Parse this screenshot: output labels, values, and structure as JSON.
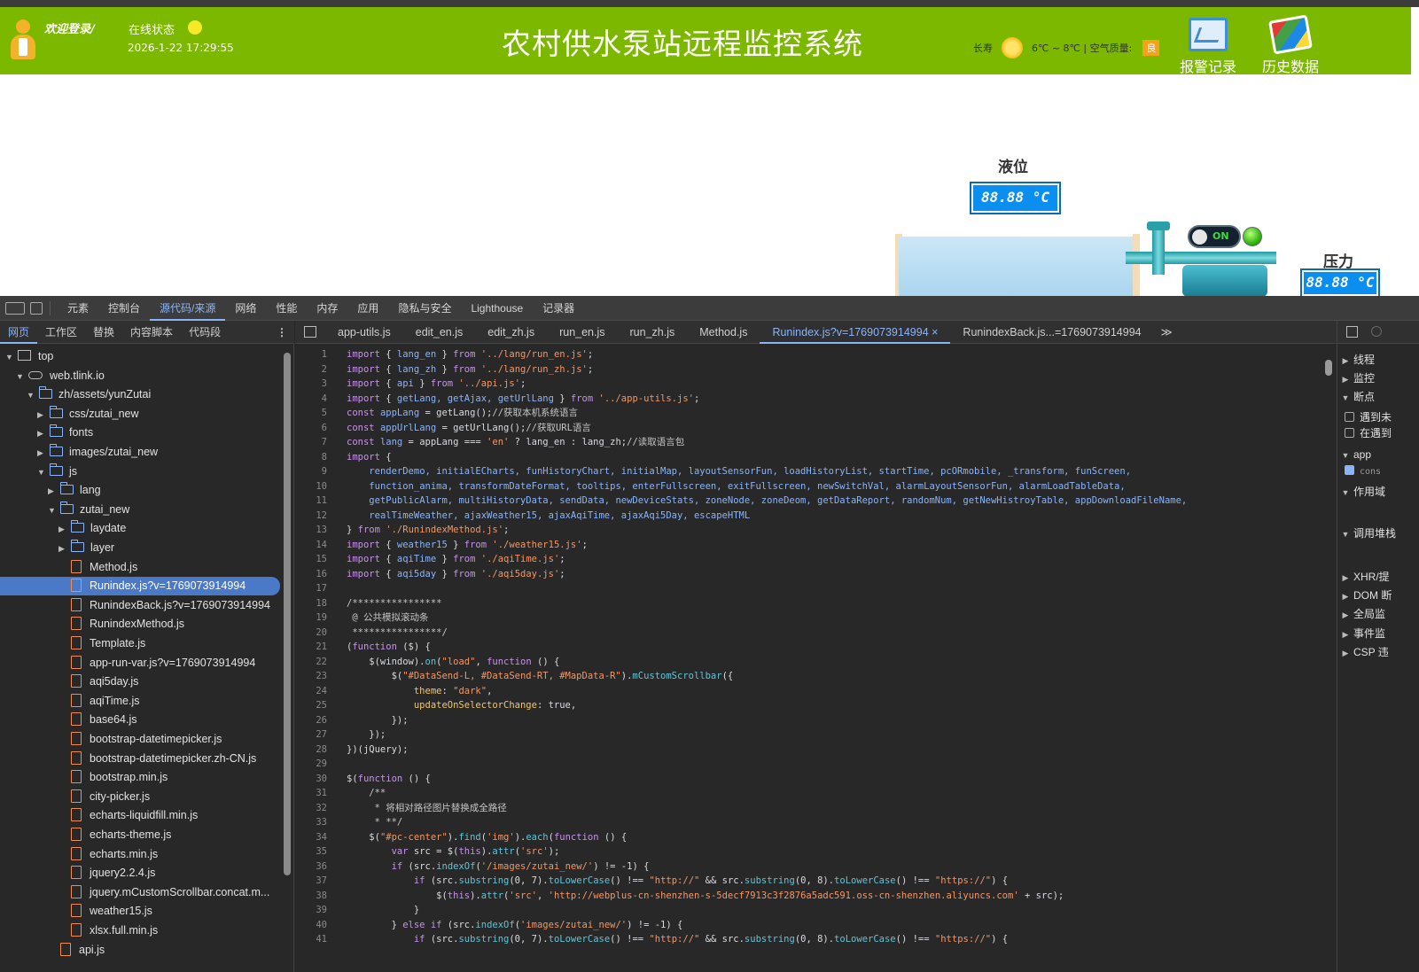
{
  "banner": {
    "welcome": "欢迎登录/",
    "status_label": "在线状态",
    "datetime": "2026-1-22 17:29:55",
    "title": "农村供水泵站远程监控系统",
    "city": "长寿",
    "temp": "6℃ ~ 8℃ | 空气质量:",
    "aqi": "良",
    "alarm_label": "报警记录",
    "history_label": "历史数据"
  },
  "scada": {
    "level_label": "液位",
    "level_value": "88.88 °C",
    "pressure_label": "压力",
    "pressure_value": "88.88 °C",
    "switch_label": "ON"
  },
  "devtools": {
    "top_tabs": [
      "元素",
      "控制台",
      "源代码/来源",
      "网络",
      "性能",
      "内存",
      "应用",
      "隐私与安全",
      "Lighthouse",
      "记录器"
    ],
    "nav_tabs": [
      "网页",
      "工作区",
      "替换",
      "内容脚本",
      "代码段"
    ],
    "file_tabs": [
      "app-utils.js",
      "edit_en.js",
      "edit_zh.js",
      "run_en.js",
      "run_zh.js",
      "Method.js",
      "Runindex.js?v=1769073914994 ×",
      "RunindexBack.js...=1769073914994"
    ],
    "more_tabs": "≫",
    "tree": [
      {
        "label": "top",
        "depth": 0,
        "type": "frame",
        "caret": "▼"
      },
      {
        "label": "web.tlink.io",
        "depth": 1,
        "type": "cloud",
        "caret": "▼"
      },
      {
        "label": "zh/assets/yunZutai",
        "depth": 2,
        "type": "folder",
        "caret": "▼"
      },
      {
        "label": "css/zutai_new",
        "depth": 3,
        "type": "folder",
        "caret": "▶"
      },
      {
        "label": "fonts",
        "depth": 3,
        "type": "folder",
        "caret": "▶"
      },
      {
        "label": "images/zutai_new",
        "depth": 3,
        "type": "folder",
        "caret": "▶"
      },
      {
        "label": "js",
        "depth": 3,
        "type": "folder",
        "caret": "▼"
      },
      {
        "label": "lang",
        "depth": 4,
        "type": "folder",
        "caret": "▶"
      },
      {
        "label": "zutai_new",
        "depth": 4,
        "type": "folder",
        "caret": "▼"
      },
      {
        "label": "laydate",
        "depth": 5,
        "type": "folder",
        "caret": "▶"
      },
      {
        "label": "layer",
        "depth": 5,
        "type": "folder",
        "caret": "▶"
      },
      {
        "label": "Method.js",
        "depth": 5,
        "type": "file",
        "caret": ""
      },
      {
        "label": "Runindex.js?v=1769073914994",
        "depth": 5,
        "type": "file",
        "caret": "",
        "selected": true
      },
      {
        "label": "RunindexBack.js?v=1769073914994",
        "depth": 5,
        "type": "file",
        "caret": ""
      },
      {
        "label": "RunindexMethod.js",
        "depth": 5,
        "type": "file",
        "caret": ""
      },
      {
        "label": "Template.js",
        "depth": 5,
        "type": "file",
        "caret": ""
      },
      {
        "label": "app-run-var.js?v=1769073914994",
        "depth": 5,
        "type": "file",
        "caret": ""
      },
      {
        "label": "aqi5day.js",
        "depth": 5,
        "type": "file",
        "caret": ""
      },
      {
        "label": "aqiTime.js",
        "depth": 5,
        "type": "file",
        "caret": ""
      },
      {
        "label": "base64.js",
        "depth": 5,
        "type": "file",
        "caret": ""
      },
      {
        "label": "bootstrap-datetimepicker.js",
        "depth": 5,
        "type": "file",
        "caret": ""
      },
      {
        "label": "bootstrap-datetimepicker.zh-CN.js",
        "depth": 5,
        "type": "file",
        "caret": ""
      },
      {
        "label": "bootstrap.min.js",
        "depth": 5,
        "type": "file",
        "caret": ""
      },
      {
        "label": "city-picker.js",
        "depth": 5,
        "type": "file",
        "caret": ""
      },
      {
        "label": "echarts-liquidfill.min.js",
        "depth": 5,
        "type": "file",
        "caret": ""
      },
      {
        "label": "echarts-theme.js",
        "depth": 5,
        "type": "file",
        "caret": ""
      },
      {
        "label": "echarts.min.js",
        "depth": 5,
        "type": "file",
        "caret": ""
      },
      {
        "label": "jquery2.2.4.js",
        "depth": 5,
        "type": "file",
        "caret": ""
      },
      {
        "label": "jquery.mCustomScrollbar.concat.m...",
        "depth": 5,
        "type": "file",
        "caret": ""
      },
      {
        "label": "weather15.js",
        "depth": 5,
        "type": "file",
        "caret": ""
      },
      {
        "label": "xlsx.full.min.js",
        "depth": 5,
        "type": "file",
        "caret": ""
      },
      {
        "label": "api.js",
        "depth": 4,
        "type": "file",
        "caret": ""
      }
    ],
    "code": [
      [
        [
          "k",
          "import"
        ],
        [
          "t",
          " { "
        ],
        [
          "i",
          "lang_en"
        ],
        [
          "t",
          " } "
        ],
        [
          "k",
          "from"
        ],
        [
          "t",
          " "
        ],
        [
          "s",
          "'../lang/run_en.js'"
        ],
        [
          "t",
          ";"
        ]
      ],
      [
        [
          "k",
          "import"
        ],
        [
          "t",
          " { "
        ],
        [
          "i",
          "lang_zh"
        ],
        [
          "t",
          " } "
        ],
        [
          "k",
          "from"
        ],
        [
          "t",
          " "
        ],
        [
          "s",
          "'../lang/run_zh.js'"
        ],
        [
          "t",
          ";"
        ]
      ],
      [
        [
          "k",
          "import"
        ],
        [
          "t",
          " { "
        ],
        [
          "i",
          "api"
        ],
        [
          "t",
          " } "
        ],
        [
          "k",
          "from"
        ],
        [
          "t",
          " "
        ],
        [
          "s",
          "'../api.js'"
        ],
        [
          "t",
          ";"
        ]
      ],
      [
        [
          "k",
          "import"
        ],
        [
          "t",
          " { "
        ],
        [
          "i",
          "getLang, getAjax, getUrlLang"
        ],
        [
          "t",
          " } "
        ],
        [
          "k",
          "from"
        ],
        [
          "t",
          " "
        ],
        [
          "s",
          "'../app-utils.js'"
        ],
        [
          "t",
          ";"
        ]
      ],
      [
        [
          "k",
          "const"
        ],
        [
          "t",
          " "
        ],
        [
          "i",
          "appLang"
        ],
        [
          "t",
          " = getLang();"
        ],
        [
          "c",
          "//获取本机系统语言"
        ]
      ],
      [
        [
          "k",
          "const"
        ],
        [
          "t",
          " "
        ],
        [
          "i",
          "appUrlLang"
        ],
        [
          "t",
          " = getUrlLang();"
        ],
        [
          "c",
          "//获取URL语言"
        ]
      ],
      [
        [
          "k",
          "const"
        ],
        [
          "t",
          " "
        ],
        [
          "i",
          "lang"
        ],
        [
          "t",
          " = appLang === "
        ],
        [
          "s",
          "'en'"
        ],
        [
          "t",
          " ? lang_en : lang_zh;"
        ],
        [
          "c",
          "//读取语言包"
        ]
      ],
      [
        [
          "k",
          "import"
        ],
        [
          "t",
          " {"
        ]
      ],
      [
        [
          "t",
          "    "
        ],
        [
          "i",
          "renderDemo, initialECharts, funHistoryChart, initialMap, layoutSensorFun, loadHistoryList, startTime, pcORmobile, _transform, funScreen,"
        ]
      ],
      [
        [
          "t",
          "    "
        ],
        [
          "i",
          "function_anima, transformDateFormat, tooltips, enterFullscreen, exitFullscreen, newSwitchVal, alarmLayoutSensorFun, alarmLoadTableData,"
        ]
      ],
      [
        [
          "t",
          "    "
        ],
        [
          "i",
          "getPublicAlarm, multiHistoryData, sendData, newDeviceStats, zoneNode, zoneDeom, getDataReport, randomNum, getNewHistroyTable, appDownloadFileName,"
        ]
      ],
      [
        [
          "t",
          "    "
        ],
        [
          "i",
          "realTimeWeather, ajaxWeather15, ajaxAqiTime, ajaxAqi5Day, escapeHTML"
        ]
      ],
      [
        [
          "t",
          "} "
        ],
        [
          "k",
          "from"
        ],
        [
          "t",
          " "
        ],
        [
          "s",
          "'./RunindexMethod.js'"
        ],
        [
          "t",
          ";"
        ]
      ],
      [
        [
          "k",
          "import"
        ],
        [
          "t",
          " { "
        ],
        [
          "i",
          "weather15"
        ],
        [
          "t",
          " } "
        ],
        [
          "k",
          "from"
        ],
        [
          "t",
          " "
        ],
        [
          "s",
          "'./weather15.js'"
        ],
        [
          "t",
          ";"
        ]
      ],
      [
        [
          "k",
          "import"
        ],
        [
          "t",
          " { "
        ],
        [
          "i",
          "aqiTime"
        ],
        [
          "t",
          " } "
        ],
        [
          "k",
          "from"
        ],
        [
          "t",
          " "
        ],
        [
          "s",
          "'./aqiTime.js'"
        ],
        [
          "t",
          ";"
        ]
      ],
      [
        [
          "k",
          "import"
        ],
        [
          "t",
          " { "
        ],
        [
          "i",
          "aqi5day"
        ],
        [
          "t",
          " } "
        ],
        [
          "k",
          "from"
        ],
        [
          "t",
          " "
        ],
        [
          "s",
          "'./aqi5day.js'"
        ],
        [
          "t",
          ";"
        ]
      ],
      [
        [
          "t",
          ""
        ]
      ],
      [
        [
          "c",
          "/****************"
        ]
      ],
      [
        [
          "c",
          " @ 公共模拟滚动条"
        ]
      ],
      [
        [
          "c",
          " ****************/"
        ]
      ],
      [
        [
          "t",
          "("
        ],
        [
          "k",
          "function"
        ],
        [
          "t",
          " ($) {"
        ]
      ],
      [
        [
          "t",
          "    $(window)."
        ],
        [
          "f",
          "on"
        ],
        [
          "t",
          "("
        ],
        [
          "s",
          "\"load\""
        ],
        [
          "t",
          ", "
        ],
        [
          "k",
          "function"
        ],
        [
          "t",
          " () {"
        ]
      ],
      [
        [
          "t",
          "        $("
        ],
        [
          "s",
          "\"#DataSend-L, #DataSend-RT, #MapData-R\""
        ],
        [
          "t",
          ")."
        ],
        [
          "f",
          "mCustomScrollbar"
        ],
        [
          "t",
          "({"
        ]
      ],
      [
        [
          "t",
          "            "
        ],
        [
          "p",
          "theme"
        ],
        [
          "t",
          ": "
        ],
        [
          "s",
          "\"dark\""
        ],
        [
          "t",
          ","
        ]
      ],
      [
        [
          "t",
          "            "
        ],
        [
          "p",
          "updateOnSelectorChange"
        ],
        [
          "t",
          ": true,"
        ]
      ],
      [
        [
          "t",
          "        });"
        ]
      ],
      [
        [
          "t",
          "    });"
        ]
      ],
      [
        [
          "t",
          "})(jQuery);"
        ]
      ],
      [
        [
          "t",
          ""
        ]
      ],
      [
        [
          "t",
          "$("
        ],
        [
          "k",
          "function"
        ],
        [
          "t",
          " () {"
        ]
      ],
      [
        [
          "c",
          "    /**"
        ]
      ],
      [
        [
          "c",
          "     * 将相对路径图片替换成全路径"
        ]
      ],
      [
        [
          "c",
          "     * **/"
        ]
      ],
      [
        [
          "t",
          "    $("
        ],
        [
          "s",
          "\"#pc-center\""
        ],
        [
          "t",
          ")."
        ],
        [
          "f",
          "find"
        ],
        [
          "t",
          "("
        ],
        [
          "s",
          "'img'"
        ],
        [
          "t",
          ")."
        ],
        [
          "f",
          "each"
        ],
        [
          "t",
          "("
        ],
        [
          "k",
          "function"
        ],
        [
          "t",
          " () {"
        ]
      ],
      [
        [
          "t",
          "        "
        ],
        [
          "k",
          "var"
        ],
        [
          "t",
          " src = $("
        ],
        [
          "k",
          "this"
        ],
        [
          "t",
          ")."
        ],
        [
          "f",
          "attr"
        ],
        [
          "t",
          "("
        ],
        [
          "s",
          "'src'"
        ],
        [
          "t",
          ");"
        ]
      ],
      [
        [
          "t",
          "        "
        ],
        [
          "k",
          "if"
        ],
        [
          "t",
          " (src."
        ],
        [
          "f",
          "indexOf"
        ],
        [
          "t",
          "("
        ],
        [
          "s",
          "'/images/zutai_new/'"
        ],
        [
          "t",
          ") != -1) {"
        ]
      ],
      [
        [
          "t",
          "            "
        ],
        [
          "k",
          "if"
        ],
        [
          "t",
          " (src."
        ],
        [
          "f",
          "substring"
        ],
        [
          "t",
          "(0, 7)."
        ],
        [
          "f",
          "toLowerCase"
        ],
        [
          "t",
          "() !== "
        ],
        [
          "s",
          "\"http://\""
        ],
        [
          "t",
          " && src."
        ],
        [
          "f",
          "substring"
        ],
        [
          "t",
          "(0, 8)."
        ],
        [
          "f",
          "toLowerCase"
        ],
        [
          "t",
          "() !== "
        ],
        [
          "s",
          "\"https://\""
        ],
        [
          "t",
          ") {"
        ]
      ],
      [
        [
          "t",
          "                $("
        ],
        [
          "k",
          "this"
        ],
        [
          "t",
          ")."
        ],
        [
          "f",
          "attr"
        ],
        [
          "t",
          "("
        ],
        [
          "s",
          "'src'"
        ],
        [
          "t",
          ", "
        ],
        [
          "s",
          "'http://webplus-cn-shenzhen-s-5decf7913c3f2876a5adc591.oss-cn-shenzhen.aliyuncs.com'"
        ],
        [
          "t",
          " + src);"
        ]
      ],
      [
        [
          "t",
          "            }"
        ]
      ],
      [
        [
          "t",
          "        } "
        ],
        [
          "k",
          "else if"
        ],
        [
          "t",
          " (src."
        ],
        [
          "f",
          "indexOf"
        ],
        [
          "t",
          "("
        ],
        [
          "s",
          "'images/zutai_new/'"
        ],
        [
          "t",
          ") != -1) {"
        ]
      ],
      [
        [
          "t",
          "            "
        ],
        [
          "k",
          "if"
        ],
        [
          "t",
          " (src."
        ],
        [
          "f",
          "substring"
        ],
        [
          "t",
          "(0, 7)."
        ],
        [
          "f",
          "toLowerCase"
        ],
        [
          "t",
          "() !== "
        ],
        [
          "s",
          "\"http://\""
        ],
        [
          "t",
          " && src."
        ],
        [
          "f",
          "substring"
        ],
        [
          "t",
          "(0, 8)."
        ],
        [
          "f",
          "toLowerCase"
        ],
        [
          "t",
          "() !== "
        ],
        [
          "s",
          "\"https://\""
        ],
        [
          "t",
          ") {"
        ]
      ]
    ],
    "right_rows": [
      {
        "label": "线程",
        "kind": "section",
        "caret": "▶"
      },
      {
        "label": "监控",
        "kind": "section",
        "caret": "▶"
      },
      {
        "label": "断点",
        "kind": "section",
        "caret": "▼"
      },
      {
        "label": "遇到未",
        "kind": "check",
        "checked": false
      },
      {
        "label": "在遇到",
        "kind": "check",
        "checked": false
      },
      {
        "label": "app",
        "kind": "file",
        "caret": "▼"
      },
      {
        "label": "cons",
        "kind": "check",
        "checked": true
      },
      {
        "label": "作用域",
        "kind": "section",
        "caret": "▼"
      },
      {
        "label": "调用堆栈",
        "kind": "section",
        "caret": "▼"
      },
      {
        "label": "XHR/提",
        "kind": "section",
        "caret": "▶"
      },
      {
        "label": "DOM 断",
        "kind": "section",
        "caret": "▶"
      },
      {
        "label": "全局监",
        "kind": "section",
        "caret": "▶"
      },
      {
        "label": "事件监",
        "kind": "section",
        "caret": "▶"
      },
      {
        "label": "CSP 违",
        "kind": "section",
        "caret": "▶"
      }
    ]
  },
  "colors": {
    "banner": "#7cb800",
    "keyword": "#c792ea",
    "string": "#f29766",
    "identifier": "#8ab4f8",
    "comment": "#c5c5c5",
    "property": "#f0c674",
    "function": "#62c3d6"
  }
}
